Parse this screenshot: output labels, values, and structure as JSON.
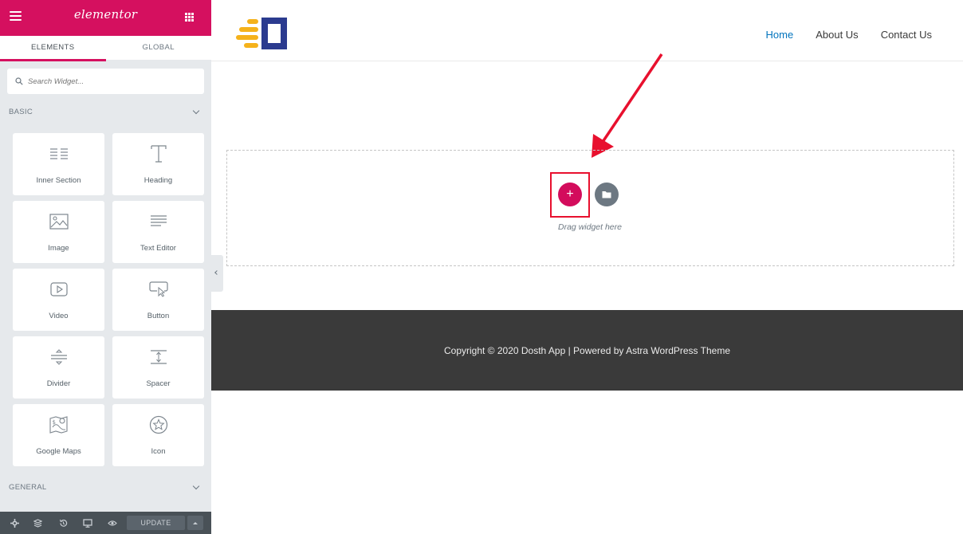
{
  "sidebar": {
    "brand": "elementor",
    "tabs": [
      {
        "label": "ELEMENTS",
        "active": true
      },
      {
        "label": "GLOBAL",
        "active": false
      }
    ],
    "search_placeholder": "Search Widget...",
    "categories": {
      "basic": {
        "label": "BASIC"
      },
      "general": {
        "label": "GENERAL"
      }
    },
    "widgets": [
      {
        "label": "Inner Section",
        "icon": "columns-icon"
      },
      {
        "label": "Heading",
        "icon": "heading-icon"
      },
      {
        "label": "Image",
        "icon": "image-icon"
      },
      {
        "label": "Text Editor",
        "icon": "text-editor-icon"
      },
      {
        "label": "Video",
        "icon": "video-icon"
      },
      {
        "label": "Button",
        "icon": "button-icon"
      },
      {
        "label": "Divider",
        "icon": "divider-icon"
      },
      {
        "label": "Spacer",
        "icon": "spacer-icon"
      },
      {
        "label": "Google Maps",
        "icon": "map-icon"
      },
      {
        "label": "Icon",
        "icon": "star-icon"
      }
    ],
    "footer": {
      "update_label": "UPDATE",
      "icons": [
        "settings-icon",
        "navigator-icon",
        "history-icon",
        "responsive-icon",
        "preview-icon"
      ]
    }
  },
  "site": {
    "nav": [
      {
        "label": "Home",
        "current": true
      },
      {
        "label": "About Us",
        "current": false
      },
      {
        "label": "Contact Us",
        "current": false
      }
    ],
    "drop_zone": {
      "text": "Drag widget here"
    },
    "footer_text": "Copyright © 2020 Dosth App | Powered by Astra WordPress Theme"
  },
  "colors": {
    "accent": "#d5105f",
    "link": "#0274be",
    "footer_bg": "#3a3a3a",
    "annotation": "#e8102e",
    "logo_blue": "#2b3b8f",
    "logo_yellow": "#f5b21b"
  }
}
